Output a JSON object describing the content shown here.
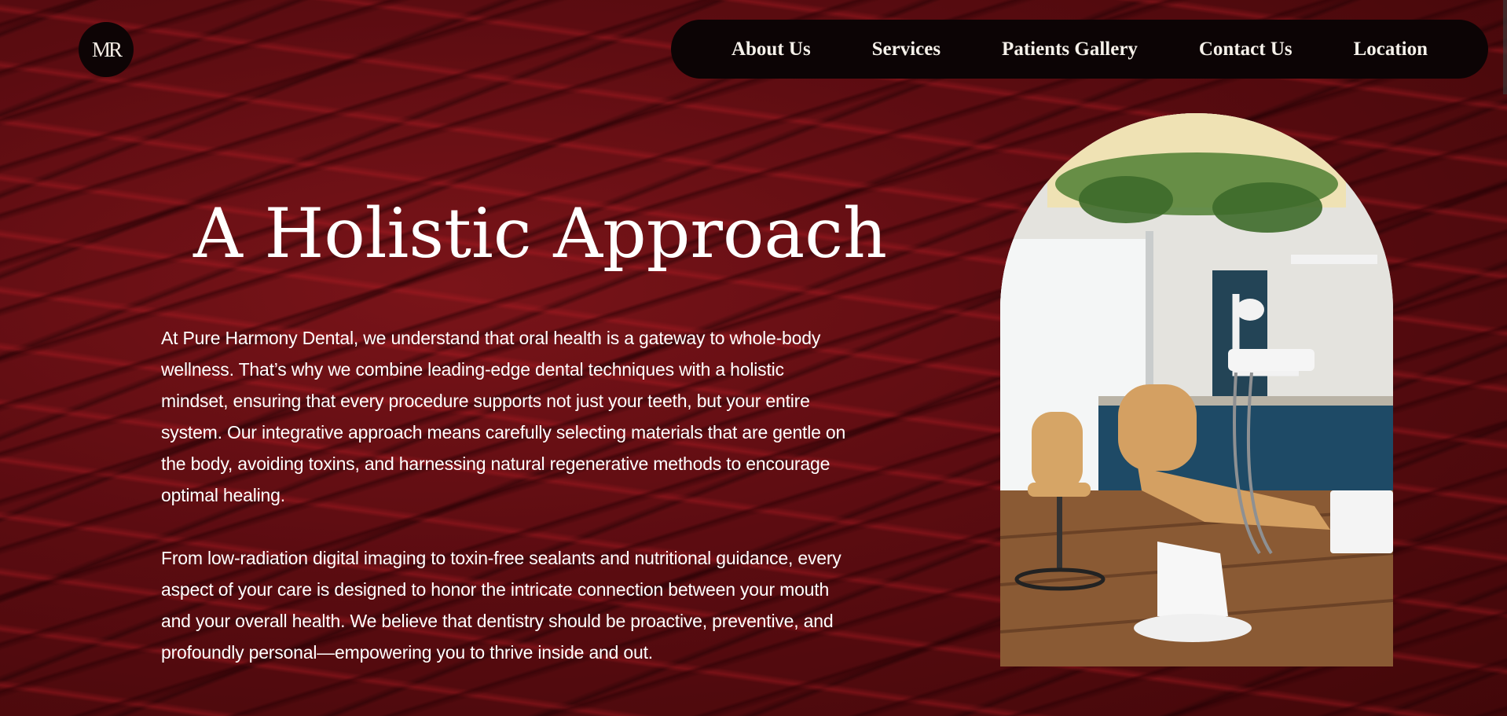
{
  "logo": {
    "text": "MR"
  },
  "nav": {
    "items": [
      {
        "label": "About Us"
      },
      {
        "label": "Services"
      },
      {
        "label": "Patients Gallery"
      },
      {
        "label": "Contact Us"
      },
      {
        "label": "Location"
      }
    ]
  },
  "hero": {
    "title": "A Holistic Approach",
    "paragraphs": [
      "At Pure Harmony Dental, we understand that oral health is a gateway to whole-body wellness. That’s why we combine leading-edge dental techniques with a holistic mindset, ensuring that every procedure supports not just your teeth, but your entire system. Our integrative approach means carefully selecting materials that are gentle on the body, avoiding toxins, and harnessing natural regenerative methods to encourage optimal healing.",
      "From low-radiation digital imaging to toxin-free sealants and nutritional guidance, every aspect of your care is designed to honor the intricate connection between your mouth and your overall health. We believe that dentistry should be proactive, preventive, and profoundly personal—empowering you to thrive inside and out."
    ]
  },
  "colors": {
    "background": "#5a0b10",
    "nav_background": "#0c0405",
    "text": "#ffffff"
  }
}
